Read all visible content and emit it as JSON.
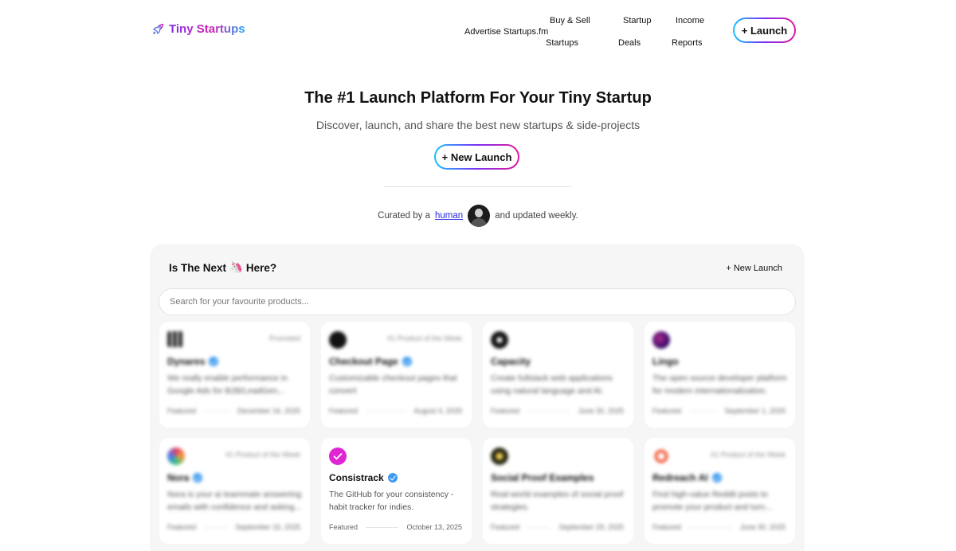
{
  "header": {
    "logo_text": "Tiny Startups",
    "nav": {
      "advertise": "Advertise",
      "startupsfm": "Startups.fm",
      "buy_sell_1": "Buy & Sell",
      "buy_sell_2": "Startups",
      "deals_1": "Startup",
      "deals_2": "Deals",
      "income_1": "Income",
      "income_2": "Reports"
    },
    "launch_button": "+ Launch"
  },
  "hero": {
    "title": "The #1 Launch Platform For Your Tiny Startup",
    "subtitle": "Discover, launch, and share the best new startups & side-projects",
    "new_launch_button": "+ New Launch",
    "curated_prefix": "Curated by a",
    "curated_link": "human",
    "curated_suffix": "and updated weekly."
  },
  "panel": {
    "title_before": "Is The Next",
    "title_emoji": "🦄",
    "title_after": "Here?",
    "new_launch_link": "+ New Launch",
    "search_placeholder": "Search for your favourite products...",
    "cards": [
      {
        "name": "Dynares",
        "badge": "Promoted",
        "desc": "We really enable performance in Google Ads for B2B/LeadGen...",
        "tag": "Featured",
        "date": "December 16, 2025",
        "icon": "grid-icon",
        "color": "#3a3a3a"
      },
      {
        "name": "Checkout Page",
        "badge": "#1 Product of the Week",
        "desc": "Customizable checkout pages that convert",
        "tag": "Featured",
        "date": "August 4, 2025",
        "icon": "checkout-icon",
        "color": "#111111"
      },
      {
        "name": "Capacity",
        "badge": "",
        "desc": "Create fullstack web applications using natural language and AI.",
        "tag": "Featured",
        "date": "June 30, 2025",
        "icon": "capacity-icon",
        "color": "#151515"
      },
      {
        "name": "Lingo",
        "badge": "",
        "desc": "The open source developer platform for modern internationalization.",
        "tag": "Featured",
        "date": "September 1, 2025",
        "icon": "lingo-icon",
        "color": "#3b0d6e"
      },
      {
        "name": "Nora",
        "badge": "#1 Product of the Week",
        "desc": "Nora is your ai teammate answering emails with confidence and asking...",
        "tag": "Featured",
        "date": "September 15, 2025",
        "icon": "nora-icon",
        "color": "#e0406b"
      },
      {
        "name": "Consistrack",
        "badge": "",
        "desc": "The GitHub for your consistency - habit tracker for indies.",
        "tag": "Featured",
        "date": "October 13, 2025",
        "icon": "check-icon",
        "color": "#e025d3"
      },
      {
        "name": "Social Proof Examples",
        "badge": "",
        "desc": "Real-world examples of social proof strategies.",
        "tag": "Featured",
        "date": "September 29, 2025",
        "icon": "social-proof-icon",
        "color": "#2a2a14"
      },
      {
        "name": "Redreach AI",
        "badge": "#1 Product of the Week",
        "desc": "Find high-value Reddit posts to promote your product and turn...",
        "tag": "Featured",
        "date": "June 30, 2025",
        "icon": "redreach-icon",
        "color": "#f05a3a"
      }
    ]
  }
}
